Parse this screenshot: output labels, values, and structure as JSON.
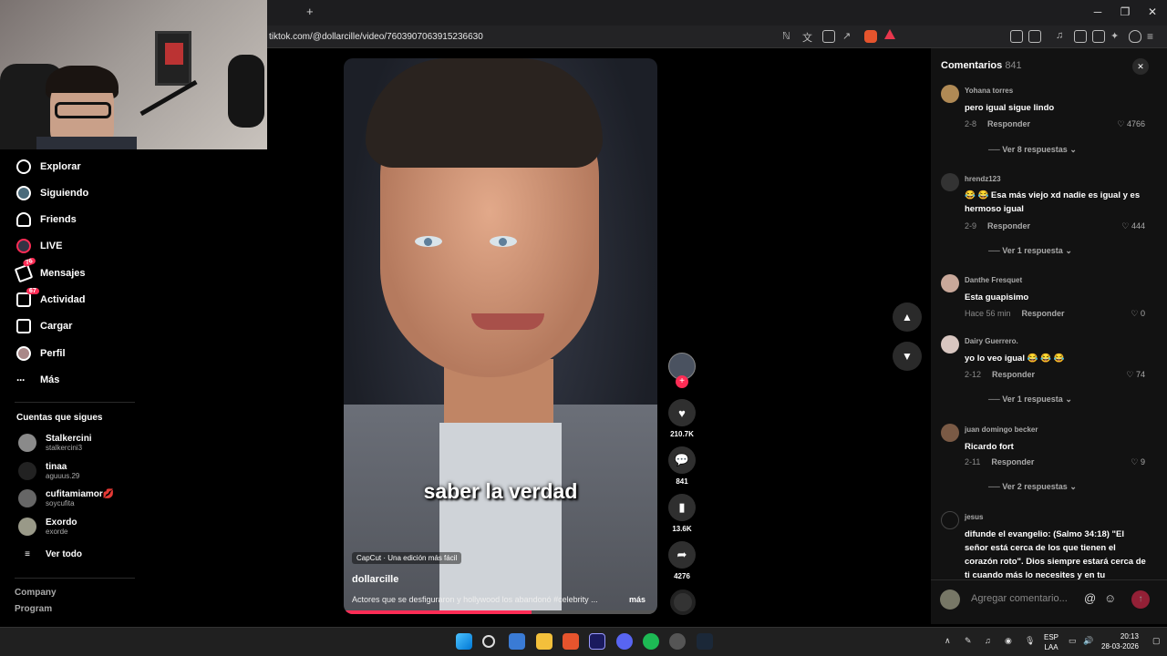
{
  "browser": {
    "url": "tiktok.com/@dollarcille/video/7603907063915236630",
    "new_tab": "+",
    "minimize": "─",
    "restore": "❐",
    "close": "✕"
  },
  "sidebar": {
    "items": [
      {
        "label": "Explorar"
      },
      {
        "label": "Siguiendo"
      },
      {
        "label": "Friends"
      },
      {
        "label": "LIVE"
      },
      {
        "label": "Mensajes",
        "badge": "76"
      },
      {
        "label": "Actividad",
        "badge": "67"
      },
      {
        "label": "Cargar"
      },
      {
        "label": "Perfil"
      },
      {
        "label": "Más"
      }
    ],
    "following_title": "Cuentas que sigues",
    "following": [
      {
        "name": "Stalkercini",
        "user": "stalkercini3"
      },
      {
        "name": "tinaa",
        "user": "aguuus.29"
      },
      {
        "name": "cufitamiamor💋",
        "user": "soycufita"
      },
      {
        "name": "Exordo",
        "user": "exorde"
      }
    ],
    "see_all": "Ver todo",
    "footer": [
      "Company",
      "Program"
    ]
  },
  "video": {
    "caption": "saber la verdad",
    "capcut": "CapCut · Una edición más fácil",
    "author": "dollarcille",
    "description": "Actores que se desfiguraron y hollywood  los abandonó #celebrity ...",
    "more": "más",
    "progress": 0.6
  },
  "actions": {
    "likes": "210.7K",
    "comments": "841",
    "saves": "13.6K",
    "shares": "4276"
  },
  "comments": {
    "title": "Comentarios",
    "count": "841",
    "reply_label": "Responder",
    "items": [
      {
        "user": "Yohana torres",
        "text": "pero igual sigue lindo",
        "date": "2-8",
        "likes": "4766",
        "replies": "Ver 8 respuestas"
      },
      {
        "user": "hrendz123",
        "text": "😂 😂 Esa más viejo xd nadie es igual y es hermoso igual",
        "date": "2-9",
        "likes": "444",
        "replies": "Ver 1 respuesta"
      },
      {
        "user": "Danthe Fresquet",
        "text": "Esta guapisimo",
        "date": "Hace 56 min",
        "likes": "0",
        "replies": ""
      },
      {
        "user": "Dairy Guerrero.",
        "text": "yo lo veo igual 😂 😂 😂",
        "date": "2-12",
        "likes": "74",
        "replies": "Ver 1 respuesta"
      },
      {
        "user": "juan domingo becker",
        "text": "Ricardo fort",
        "date": "2-11",
        "likes": "9",
        "replies": "Ver 2 respuestas"
      },
      {
        "user": "jesus",
        "text": "difunde el evangelio: (Salmo 34:18) \"El señor está cerca de los que tienen el corazón roto\". Dios siempre estará cerca de ti cuando más lo necesites y en tu",
        "date": "",
        "likes": "",
        "replies": ""
      }
    ],
    "input_placeholder": "Agregar comentario..."
  },
  "taskbar": {
    "lang1": "ESP",
    "lang2": "LAA",
    "time": "20:13",
    "date": "28-03-2026"
  }
}
